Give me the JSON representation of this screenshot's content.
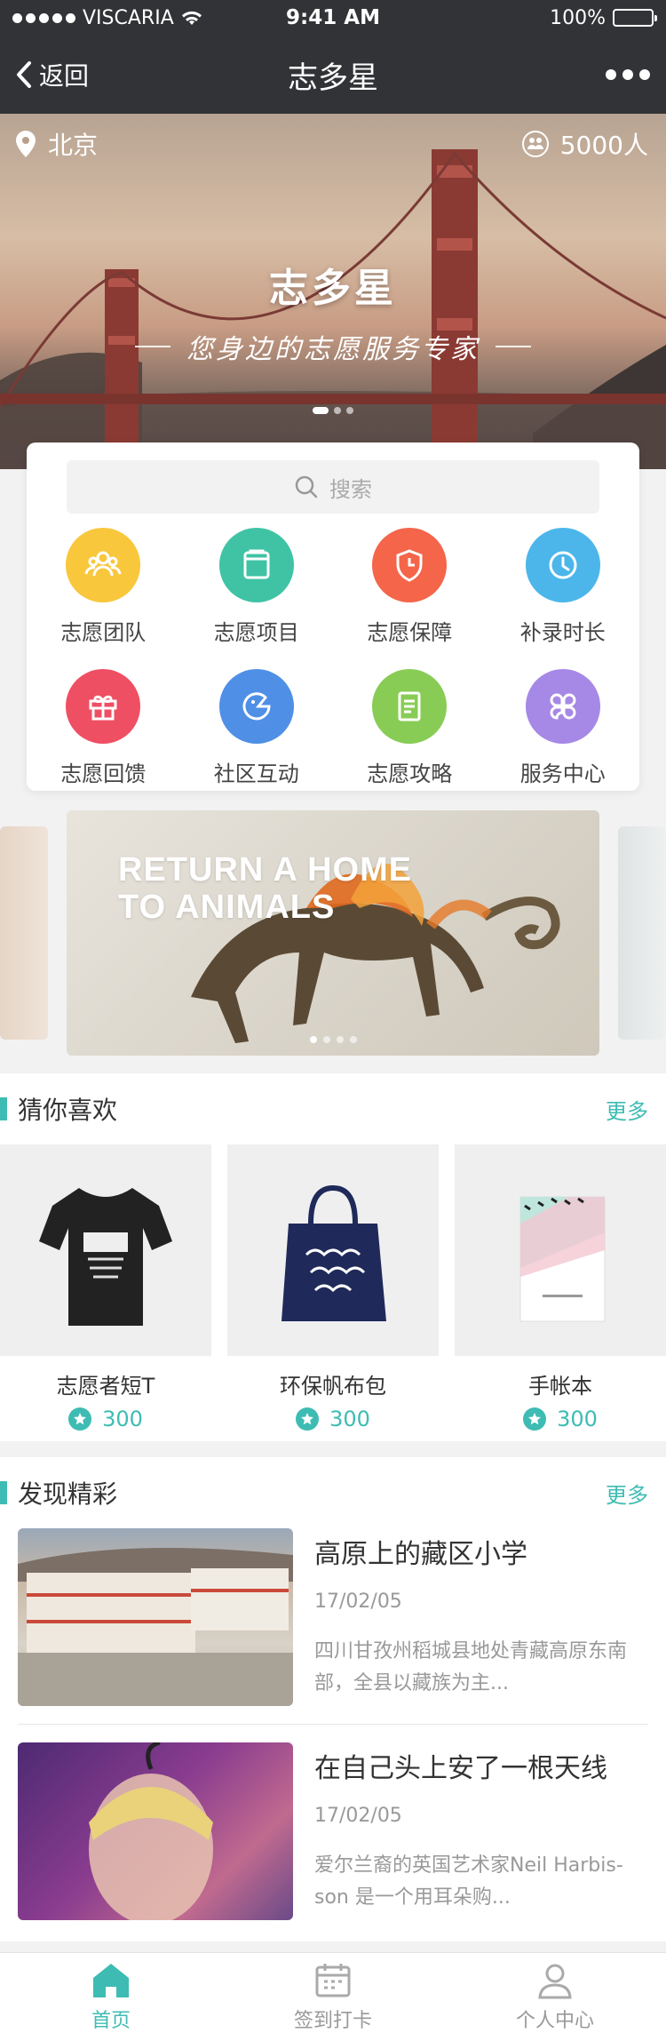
{
  "status": {
    "carrier": "VISCARIA",
    "time": "9:41 AM",
    "battery": "100%"
  },
  "nav": {
    "back_label": "返回",
    "title": "志多星"
  },
  "hero": {
    "location": "北京",
    "people": "5000人",
    "title": "志多星",
    "subtitle": "您身边的志愿服务专家"
  },
  "search": {
    "placeholder": "搜索"
  },
  "grid": [
    {
      "label": "志愿团队",
      "color": "#f9c73c",
      "icon": "team-icon"
    },
    {
      "label": "志愿项目",
      "color": "#3fc3a4",
      "icon": "project-icon"
    },
    {
      "label": "志愿保障",
      "color": "#f4654a",
      "icon": "shield-icon"
    },
    {
      "label": "补录时长",
      "color": "#4cb6ea",
      "icon": "clock-icon"
    },
    {
      "label": "志愿回馈",
      "color": "#ef4f63",
      "icon": "gift-icon"
    },
    {
      "label": "社区互动",
      "color": "#4f8fe6",
      "icon": "chat-icon"
    },
    {
      "label": "志愿攻略",
      "color": "#88cc55",
      "icon": "guide-icon"
    },
    {
      "label": "服务中心",
      "color": "#a688e6",
      "icon": "service-icon"
    }
  ],
  "banner": {
    "line1": "RETURN A HOME",
    "line2": "TO ANIMALS"
  },
  "guess": {
    "title": "猜你喜欢",
    "more": "更多",
    "items": [
      {
        "name": "志愿者短T",
        "price": "300"
      },
      {
        "name": "环保帆布包",
        "price": "300"
      },
      {
        "name": "手帐本",
        "price": "300"
      }
    ]
  },
  "discover": {
    "title": "发现精彩",
    "more": "更多",
    "items": [
      {
        "title": "高原上的藏区小学",
        "date": "17/02/05",
        "desc": "四川甘孜州稻城县地处青藏高原东南部，全县以藏族为主..."
      },
      {
        "title": "在自己头上安了一根天线",
        "date": "17/02/05",
        "desc": "爱尔兰裔的英国艺术家Neil Harbis-son 是一个用耳朵购..."
      }
    ]
  },
  "tabs": [
    {
      "label": "首页",
      "active": true
    },
    {
      "label": "签到打卡",
      "active": false
    },
    {
      "label": "个人中心",
      "active": false
    }
  ],
  "colors": {
    "accent": "#3ebcb3",
    "topbar": "#313336"
  }
}
